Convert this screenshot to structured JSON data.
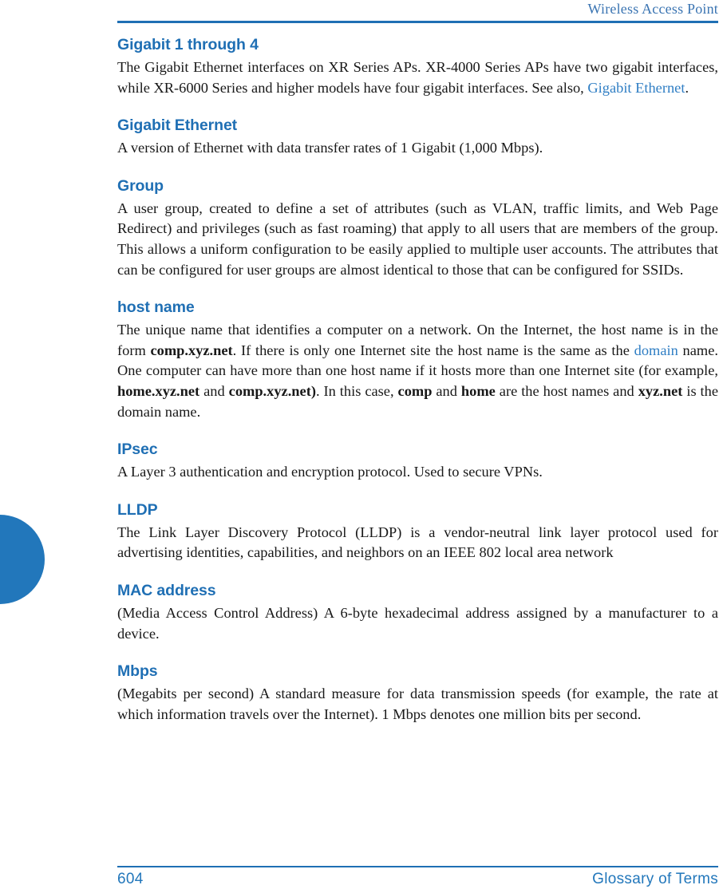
{
  "header": {
    "running_title": "Wireless Access Point"
  },
  "footer": {
    "page_number": "604",
    "section_name": "Glossary of Terms"
  },
  "colors": {
    "heading_blue": "#1f6fb4",
    "link_blue": "#2f7ec4",
    "tab_blue": "#2277bb",
    "header_blue": "#3a74b2",
    "body_text": "#181818"
  },
  "sections": [
    {
      "term": "Gigabit 1 through 4",
      "def_parts": [
        {
          "t": "The Gigabit Ethernet interfaces on XR Series APs. XR-4000 Series APs have two gigabit interfaces, while XR-6000 Series and higher models have four gigabit interfaces. See also, ",
          "s": "plain"
        },
        {
          "t": "Gigabit Ethernet",
          "s": "link"
        },
        {
          "t": ".",
          "s": "plain"
        }
      ]
    },
    {
      "term": "Gigabit Ethernet",
      "def_parts": [
        {
          "t": "A version of Ethernet with data transfer rates of 1 Gigabit (1,000 Mbps).",
          "s": "plain"
        }
      ]
    },
    {
      "term": "Group",
      "def_parts": [
        {
          "t": "A user group, created to define a set of attributes (such as VLAN, traffic limits, and Web Page Redirect) and privileges (such as fast roaming) that apply to all users that are members of the group. This allows a uniform configuration to be easily applied to multiple user accounts. The attributes that can be configured for user groups are almost identical to those that can be configured for SSIDs.",
          "s": "plain"
        }
      ]
    },
    {
      "term": "host name",
      "def_parts": [
        {
          "t": "The unique name that identifies a computer on a network. On the Internet, the host name is in the form ",
          "s": "plain"
        },
        {
          "t": "comp.xyz.net",
          "s": "bold"
        },
        {
          "t": ". If there is only one Internet site the host name is the same as the ",
          "s": "plain"
        },
        {
          "t": "domain",
          "s": "link"
        },
        {
          "t": " name. One computer can have more than one host name if it hosts more than one Internet site (for example, ",
          "s": "plain"
        },
        {
          "t": "home.xyz.net",
          "s": "bold"
        },
        {
          "t": " and ",
          "s": "plain"
        },
        {
          "t": "comp.xyz.net)",
          "s": "bold"
        },
        {
          "t": ". In this case, ",
          "s": "plain"
        },
        {
          "t": "comp",
          "s": "bold"
        },
        {
          "t": " and ",
          "s": "plain"
        },
        {
          "t": "home",
          "s": "bold"
        },
        {
          "t": " are the host names and ",
          "s": "plain"
        },
        {
          "t": "xyz.net",
          "s": "bold"
        },
        {
          "t": " is the domain name.",
          "s": "plain"
        }
      ]
    },
    {
      "term": "IPsec",
      "def_parts": [
        {
          "t": "A Layer 3 authentication and encryption protocol. Used to secure VPNs.",
          "s": "plain"
        }
      ]
    },
    {
      "term": "LLDP",
      "def_parts": [
        {
          "t": "The Link Layer Discovery Protocol (LLDP) is a vendor-neutral link layer protocol used for advertising identities, capabilities, and neighbors on an IEEE 802 local area network",
          "s": "plain"
        }
      ]
    },
    {
      "term": "MAC address",
      "def_parts": [
        {
          "t": "(Media Access Control Address) A 6-byte hexadecimal address assigned by a manufacturer to a device.",
          "s": "plain"
        }
      ]
    },
    {
      "term": "Mbps",
      "def_parts": [
        {
          "t": "(Megabits per second) A standard measure for data transmission speeds (for example, the rate at which information travels over the Internet). 1 Mbps denotes one million bits per second.",
          "s": "plain"
        }
      ]
    }
  ]
}
